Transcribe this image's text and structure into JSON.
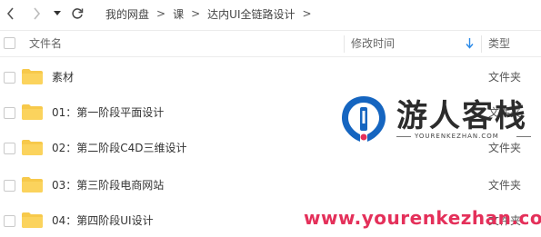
{
  "breadcrumb": [
    "我的网盘",
    "课",
    "达内UI全链路设计"
  ],
  "header": {
    "name": "文件名",
    "modified": "修改时间",
    "type": "类型"
  },
  "rows": [
    {
      "name": "素材",
      "type": "文件夹"
    },
    {
      "name": "01：第一阶段平面设计",
      "type": "文件夹"
    },
    {
      "name": "02：第二阶段C4D三维设计",
      "type": "文件夹"
    },
    {
      "name": "03：第三阶段电商网站",
      "type": "文件夹"
    },
    {
      "name": "04：第四阶段UI设计",
      "type": "文件夹"
    }
  ],
  "watermark": {
    "title": "游人客栈",
    "subtitle": "YOURENKEZHAN.COM",
    "url": "www.yourenkezhan.com"
  },
  "colors": {
    "folder": "#f7c94b",
    "accent": "#2b8ae8",
    "watermark_url": "#e4305a",
    "logo": "#1565c0"
  }
}
